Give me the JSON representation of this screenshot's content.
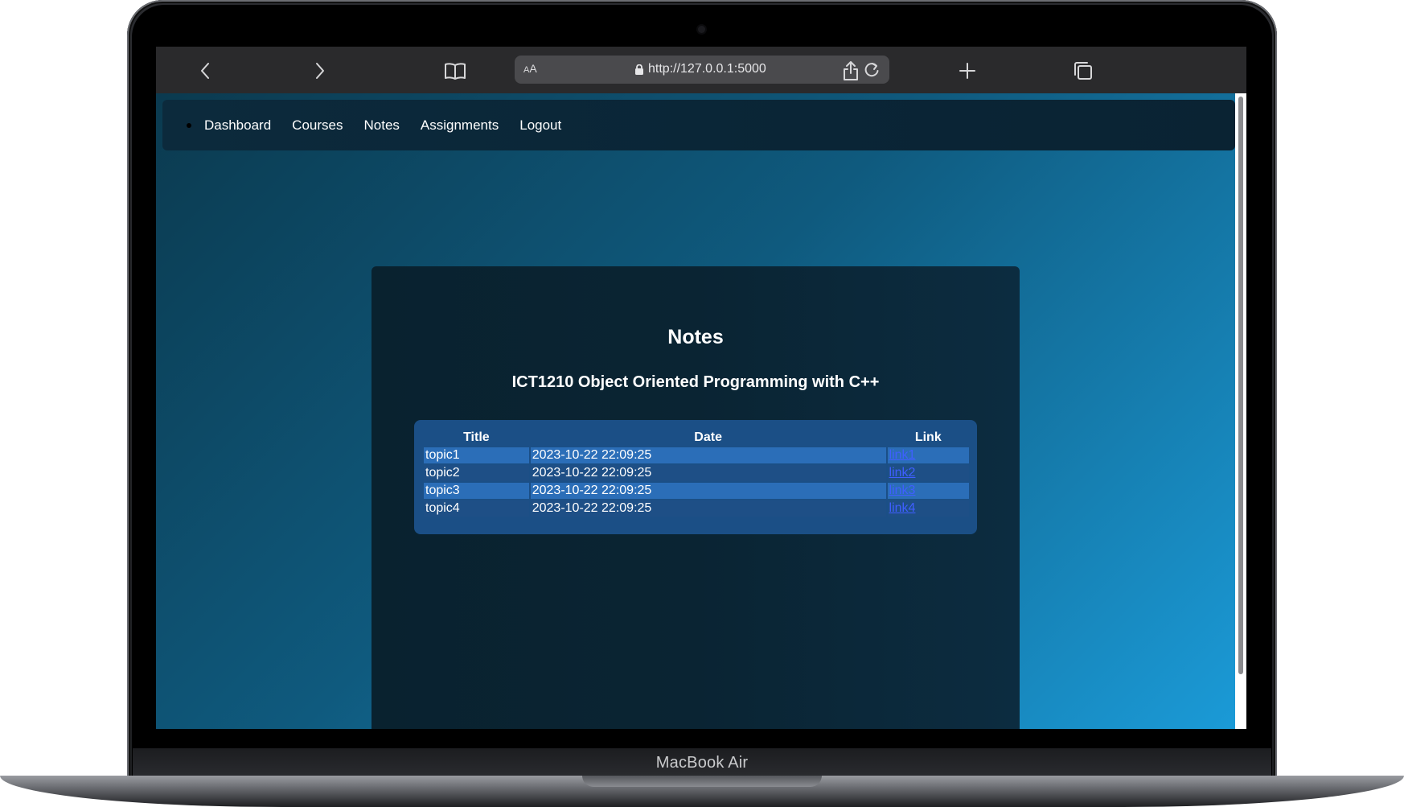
{
  "device": {
    "label": "MacBook Air"
  },
  "browser": {
    "aa_label": "AA",
    "url": "http://127.0.0.1:5000"
  },
  "nav": {
    "items": [
      {
        "label": "Dashboard"
      },
      {
        "label": "Courses"
      },
      {
        "label": "Notes"
      },
      {
        "label": "Assignments"
      },
      {
        "label": "Logout"
      }
    ]
  },
  "page": {
    "title": "Notes",
    "course": "ICT1210 Object Oriented Programming with C++"
  },
  "notes_table": {
    "headers": {
      "title": "Title",
      "date": "Date",
      "link": "Link"
    },
    "rows": [
      {
        "title": "topic1",
        "date": "2023-10-22 22:09:25",
        "link": "link1"
      },
      {
        "title": "topic2",
        "date": "2023-10-22 22:09:25",
        "link": "link2"
      },
      {
        "title": "topic3",
        "date": "2023-10-22 22:09:25",
        "link": "link3"
      },
      {
        "title": "topic4",
        "date": "2023-10-22 22:09:25",
        "link": "link4"
      }
    ]
  },
  "colors": {
    "background_gradient_start": "#0b3a4f",
    "background_gradient_end": "#1b9bd8",
    "table_row_odd": "#2b6eb8",
    "table_row_even": "#1e4f86",
    "link": "#3f5fff"
  }
}
